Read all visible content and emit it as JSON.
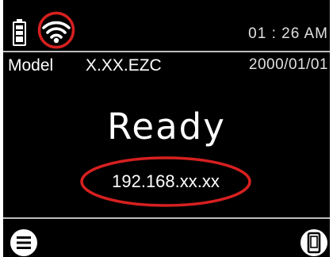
{
  "status_bar": {
    "battery_icon": "battery-full-icon",
    "wifi_icon": "wifi-icon",
    "time": "01 : 26 AM"
  },
  "info_row": {
    "model_label": "Model",
    "model_value": "X.XX.EZC",
    "date": "2000/01/01"
  },
  "main": {
    "status": "Ready",
    "ip_address": "192.168.xx.xx"
  },
  "footer": {
    "menu_icon": "menu-icon",
    "device_icon": "device-icon"
  },
  "colors": {
    "screen_background": "#000000",
    "text": "#ffffff",
    "highlight": "#d62020",
    "divider": "#bdbdbd"
  }
}
